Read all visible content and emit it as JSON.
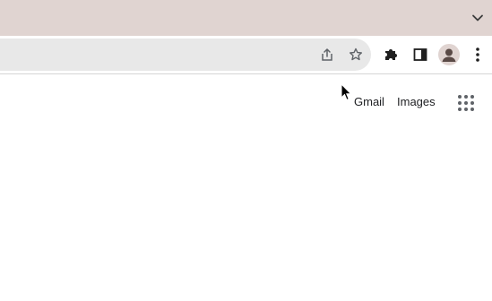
{
  "browser": {
    "tabstrip_color": "#e0d4d1",
    "tab_search_icon": "chevron-down-icon",
    "omnibox": {
      "share_icon": "share-icon",
      "bookmark_icon": "star-icon"
    },
    "toolbar_icons": [
      "puzzle-icon",
      "side-panel-icon",
      "avatar-icon",
      "kebab-menu-icon"
    ]
  },
  "page": {
    "links": {
      "gmail": "Gmail",
      "images": "Images"
    },
    "apps_icon": "apps-grid-icon"
  }
}
